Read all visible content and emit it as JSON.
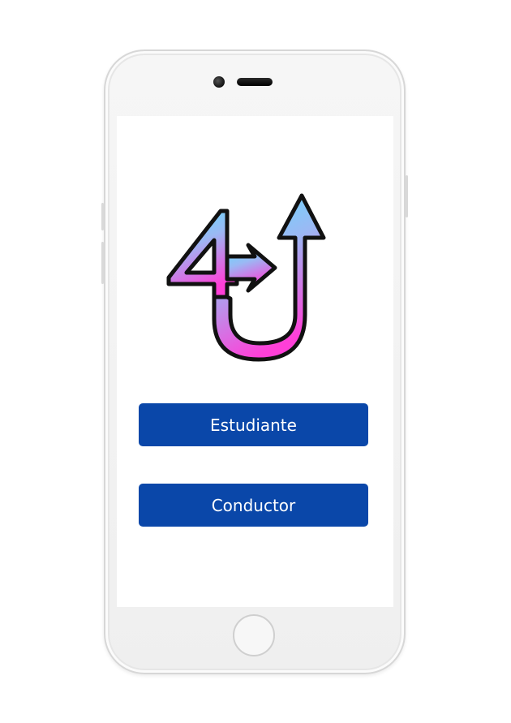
{
  "app": {
    "logo_icon": "4u-arrow-logo-icon"
  },
  "buttons": {
    "student_label": "Estudiante",
    "driver_label": "Conductor"
  },
  "colors": {
    "button_background": "#0a47a9",
    "button_text": "#ffffff",
    "logo_gradient_top": "#5be3ff",
    "logo_gradient_bottom": "#ff3fd8",
    "screen_background": "#ffffff"
  }
}
